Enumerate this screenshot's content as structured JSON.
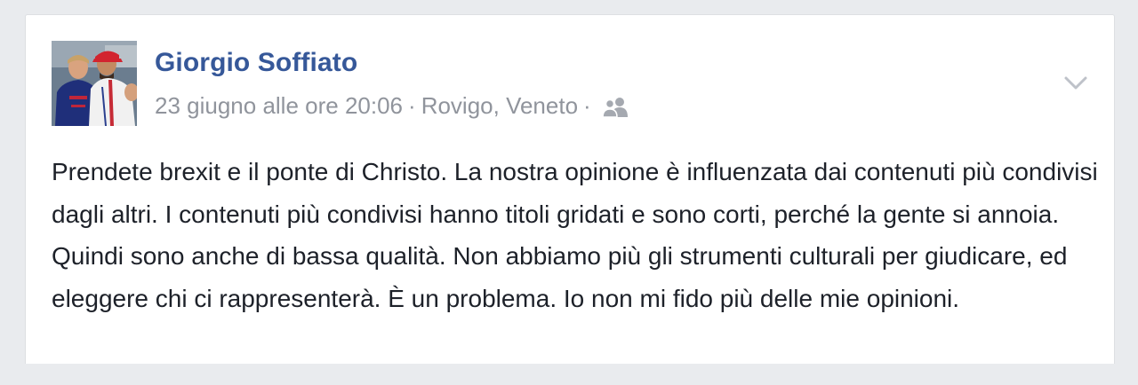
{
  "post": {
    "author_name": "Giorgio Soffiato",
    "timestamp": "23 giugno alle ore 20:06",
    "separator": "·",
    "location": "Rovigo, Veneto",
    "audience_icon": "friends-icon",
    "menu_icon": "chevron-down-icon",
    "text": "Prendete brexit e il ponte di Christo. La nostra opinione è influenzata dai contenuti più condivisi dagli altri. I contenuti più condivisi hanno titoli gridati e sono corti, perché la gente si annoia. Quindi sono anche di bassa qualità. Non abbiamo più gli strumenti culturali per giudicare, ed eleggere chi ci rappresenterà. È un problema. Io non mi fido più delle mie opinioni."
  },
  "colors": {
    "page_background": "#e9ebee",
    "card_background": "#ffffff",
    "author_link": "#365899",
    "meta_text": "#90949c",
    "body_text": "#1d2129"
  }
}
